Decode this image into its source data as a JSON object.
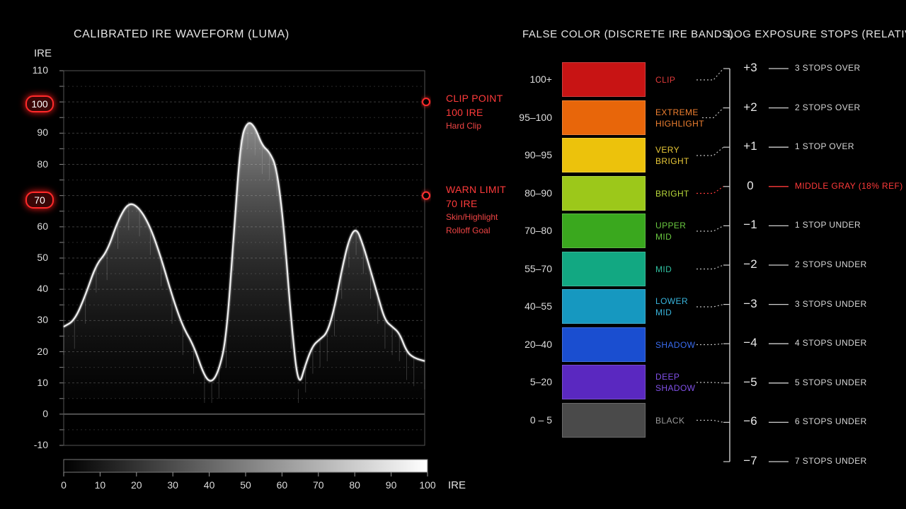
{
  "waveform": {
    "title": "CALIBRATED IRE WAVEFORM (LUMA)",
    "y_axis_label": "IRE",
    "x_axis_label": "IRE",
    "clip_badge": "100",
    "warn_badge": "70",
    "clip_annotation": [
      "CLIP POINT",
      "100 IRE",
      "Hard Clip"
    ],
    "warn_annotation": [
      "WARN LIMIT",
      "70 IRE",
      "Skin/Highlight",
      "Rolloff Goal"
    ],
    "colors": {
      "clip": "#ff2a2a",
      "warn": "#ff3030",
      "trace": "#ffffff"
    }
  },
  "chart_data": {
    "type": "line",
    "xlim": [
      0,
      100
    ],
    "ylim": [
      -10,
      110
    ],
    "y_ticks": [
      "110",
      "100",
      "90",
      "80",
      "70",
      "60",
      "50",
      "40",
      "30",
      "20",
      "10",
      "0",
      "-10"
    ],
    "x_ticks": [
      "0",
      "10",
      "20",
      "30",
      "40",
      "50",
      "60",
      "70",
      "80",
      "90",
      "100"
    ],
    "reference_lines": [
      {
        "value": 100,
        "style": "solid"
      },
      {
        "value": 70,
        "style": "dashed"
      }
    ],
    "grid": true,
    "luma_trace": {
      "x": [
        0,
        3,
        6,
        9,
        12,
        15,
        18,
        21,
        24,
        27,
        30,
        33,
        36,
        39,
        41,
        43,
        45,
        47,
        49,
        51,
        53,
        55,
        57,
        59,
        61,
        63,
        65,
        67,
        69,
        71,
        73,
        75,
        77,
        79,
        81,
        83,
        85,
        87,
        89,
        91,
        93,
        95,
        97,
        100
      ],
      "y": [
        28,
        30,
        38,
        48,
        52,
        62,
        68,
        66,
        60,
        50,
        38,
        28,
        22,
        12,
        10,
        14,
        24,
        55,
        88,
        94,
        92,
        86,
        84,
        79,
        60,
        30,
        8,
        16,
        22,
        24,
        26,
        34,
        46,
        56,
        60,
        54,
        46,
        38,
        30,
        28,
        26,
        20,
        18,
        17
      ]
    }
  },
  "false_color": {
    "title": "FALSE COLOR (DISCRETE IRE BANDS)",
    "bands": [
      {
        "range": "100+",
        "name": [
          "CLIP"
        ],
        "color": "#c81414",
        "label_color": "#e03a3a"
      },
      {
        "range": "95–100",
        "name": [
          "EXTREME",
          "HIGHLIGHT"
        ],
        "color": "#e8660a",
        "label_color": "#f08030"
      },
      {
        "range": "90–95",
        "name": [
          "VERY",
          "BRIGHT"
        ],
        "color": "#ecc20c",
        "label_color": "#e8c838"
      },
      {
        "range": "80–90",
        "name": [
          "BRIGHT"
        ],
        "color": "#9cc81a",
        "label_color": "#b8d83a"
      },
      {
        "range": "70–80",
        "name": [
          "UPPER",
          "MID"
        ],
        "color": "#3aa81e",
        "label_color": "#6ac840"
      },
      {
        "range": "55–70",
        "name": [
          "MID"
        ],
        "color": "#12a882",
        "label_color": "#30c0a0"
      },
      {
        "range": "40–55",
        "name": [
          "LOWER",
          "MID"
        ],
        "color": "#1698c0",
        "label_color": "#38b4dc"
      },
      {
        "range": "20–40",
        "name": [
          "SHADOW"
        ],
        "color": "#1a4ed0",
        "label_color": "#3a6cf0"
      },
      {
        "range": "5–20",
        "name": [
          "DEEP",
          "SHADOW"
        ],
        "color": "#5a28c0",
        "label_color": "#8050e8"
      },
      {
        "range": "0 – 5",
        "name": [
          "BLACK"
        ],
        "color": "#4a4a4a",
        "label_color": "#9a9a9a"
      }
    ]
  },
  "exposure_stops": {
    "title": "LOG EXPOSURE STOPS (RELATIVE)",
    "stops": [
      {
        "value": "+3",
        "desc": "3 STOPS OVER"
      },
      {
        "value": "+2",
        "desc": "2 STOPS OVER"
      },
      {
        "value": "+1",
        "desc": "1 STOP OVER"
      },
      {
        "value": "0",
        "desc": "MIDDLE GRAY (18% REF)",
        "highlight": true
      },
      {
        "value": "−1",
        "desc": "1 STOP UNDER"
      },
      {
        "value": "−2",
        "desc": "2 STOPS UNDER"
      },
      {
        "value": "−3",
        "desc": "3 STOPS UNDER"
      },
      {
        "value": "−4",
        "desc": "4 STOPS UNDER"
      },
      {
        "value": "−5",
        "desc": "5 STOPS UNDER"
      },
      {
        "value": "−6",
        "desc": "6 STOPS UNDER"
      },
      {
        "value": "−7",
        "desc": "7 STOPS UNDER"
      }
    ],
    "highlight_color": "#ff3a3a"
  }
}
